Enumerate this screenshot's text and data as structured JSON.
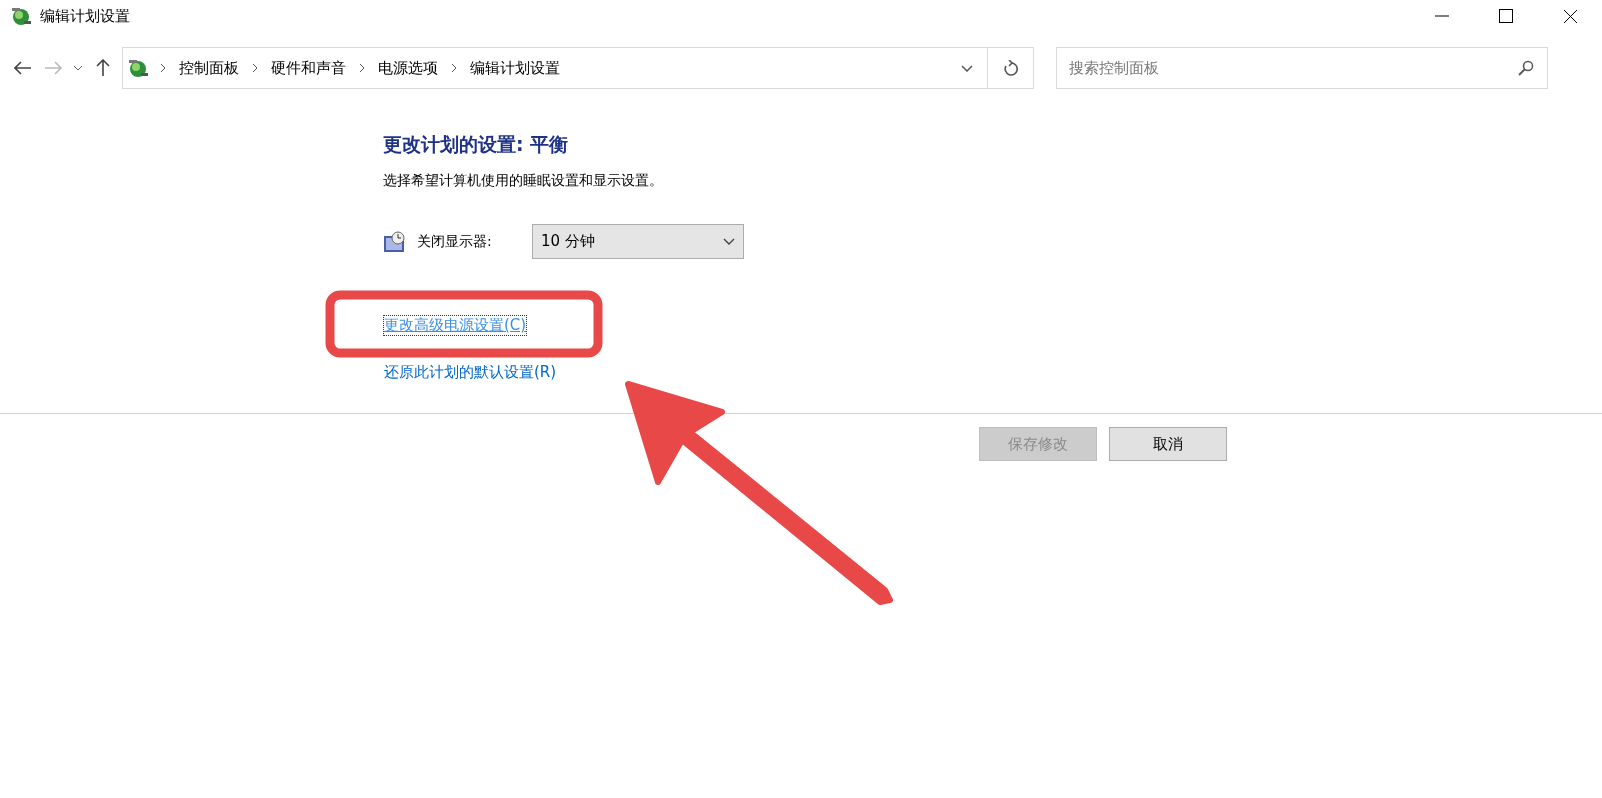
{
  "window": {
    "title": "编辑计划设置"
  },
  "breadcrumb": [
    "控制面板",
    "硬件和声音",
    "电源选项",
    "编辑计划设置"
  ],
  "search": {
    "placeholder": "搜索控制面板"
  },
  "heading": "更改计划的设置: 平衡",
  "description": "选择希望计算机使用的睡眠设置和显示设置。",
  "settings": [
    {
      "label": "关闭显示器:",
      "value": "10 分钟"
    }
  ],
  "links": [
    {
      "label": "更改高级电源设置(C)",
      "focused": true
    },
    {
      "label": "还原此计划的默认设置(R)",
      "focused": false
    }
  ],
  "buttons": [
    {
      "label": "保存修改",
      "disabled": true
    },
    {
      "label": "取消",
      "disabled": false
    }
  ],
  "annotation": {
    "kind": "highlight-arrow"
  }
}
